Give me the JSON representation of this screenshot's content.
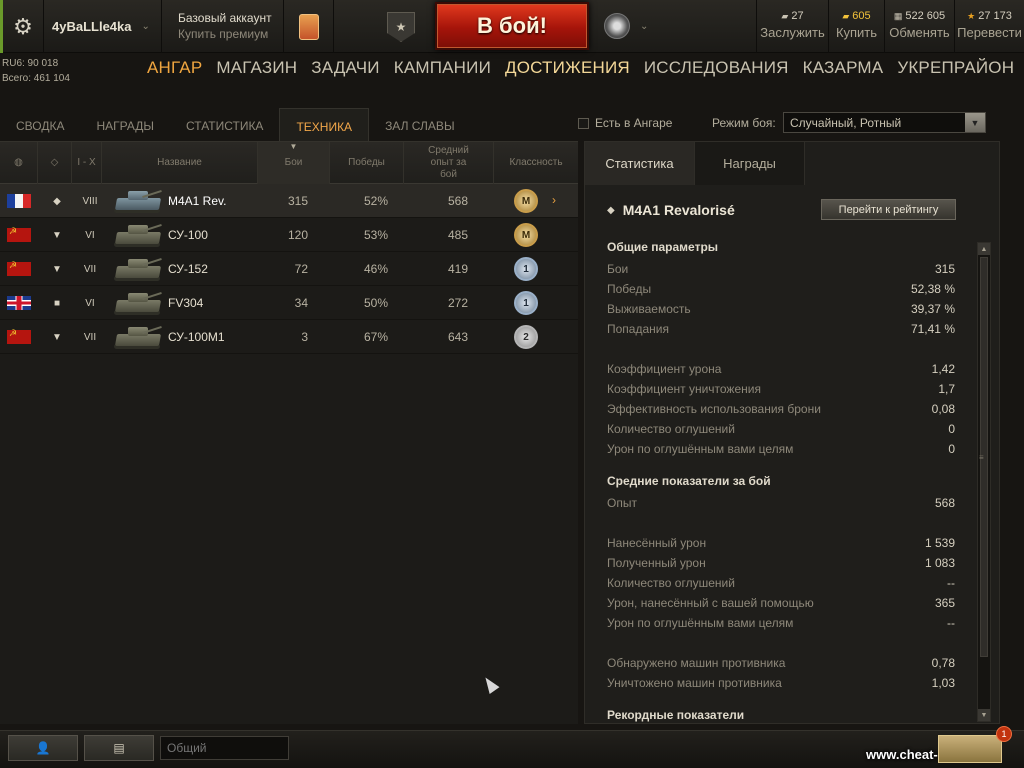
{
  "header": {
    "player_name": "4yBaLLle4ka",
    "account_type": "Базовый аккаунт",
    "buy_premium": "Купить премиум",
    "battle_button": "В бой!",
    "currencies": [
      {
        "id": "xp",
        "amount": "27",
        "caption": "Заслужить",
        "icon": "xp-icon",
        "color": "#c9c3b3"
      },
      {
        "id": "gold",
        "amount": "605",
        "caption": "Купить",
        "icon": "gold-icon",
        "color": "#f2c23a"
      },
      {
        "id": "credits",
        "amount": "522 605",
        "caption": "Обменять",
        "icon": "credits-icon",
        "color": "#c9c3b3"
      },
      {
        "id": "free_xp",
        "amount": "27 173",
        "caption": "Перевести",
        "icon": "free-xp-icon",
        "color": "#e8a020"
      }
    ]
  },
  "left_stats": {
    "rub": "RU6: 90 018",
    "total": "Всего: 461 104"
  },
  "nav": {
    "items": [
      "АНГАР",
      "МАГАЗИН",
      "ЗАДАЧИ",
      "КАМПАНИИ",
      "ДОСТИЖЕНИЯ",
      "ИССЛЕДОВАНИЯ",
      "КАЗАРМА",
      "УКРЕПРАЙОН"
    ],
    "active_hangar": "АНГАР",
    "active_section": "ДОСТИЖЕНИЯ"
  },
  "subtabs": [
    "СВОДКА",
    "НАГРАДЫ",
    "СТАТИСТИКА",
    "ТЕХНИКА",
    "ЗАЛ СЛАВЫ"
  ],
  "active_subtab": "ТЕХНИКА",
  "filter": {
    "in_hangar_label": "Есть в Ангаре",
    "in_hangar_checked": false,
    "mode_label": "Режим боя:",
    "mode_value": "Случайный, Ротный"
  },
  "table": {
    "headers": {
      "tier": "I - X",
      "name": "Название",
      "battles": "Бои",
      "wins": "Победы",
      "avg_xp": "Средний опыт за бой",
      "mastery": "Классность"
    },
    "rows": [
      {
        "nation": "france",
        "type": "heavy",
        "tier": "VIII",
        "name": "M4A1 Rev.",
        "battles": "315",
        "wins": "52%",
        "avg_xp": "568",
        "mastery": "M",
        "selected": true
      },
      {
        "nation": "ussr",
        "type": "td",
        "tier": "VI",
        "name": "СУ-100",
        "battles": "120",
        "wins": "53%",
        "avg_xp": "485",
        "mastery": "M",
        "selected": false
      },
      {
        "nation": "ussr",
        "type": "td",
        "tier": "VII",
        "name": "СУ-152",
        "battles": "72",
        "wins": "46%",
        "avg_xp": "419",
        "mastery": "1",
        "selected": false
      },
      {
        "nation": "uk",
        "type": "spg",
        "tier": "VI",
        "name": "FV304",
        "battles": "34",
        "wins": "50%",
        "avg_xp": "272",
        "mastery": "1",
        "selected": false
      },
      {
        "nation": "ussr",
        "type": "td",
        "tier": "VII",
        "name": "СУ-100М1",
        "battles": "3",
        "wins": "67%",
        "avg_xp": "643",
        "mastery": "2",
        "selected": false
      }
    ]
  },
  "detail": {
    "tabs": [
      "Статистика",
      "Награды"
    ],
    "vehicle_title": "M4A1 Revalorisé",
    "rating_button": "Перейти к рейтингу",
    "sections": {
      "general": "Общие параметры",
      "average": "Средние показатели за бой",
      "records": "Рекордные показатели"
    },
    "general_rows": [
      {
        "label": "Бои",
        "value": "315"
      },
      {
        "label": "Победы",
        "value": "52,38 %"
      },
      {
        "label": "Выживаемость",
        "value": "39,37 %"
      },
      {
        "label": "Попадания",
        "value": "71,41 %"
      },
      {
        "label": "Коэффициент урона",
        "value": "1,42"
      },
      {
        "label": "Коэффициент уничтожения",
        "value": "1,7"
      },
      {
        "label": "Эффективность использования брони",
        "value": "0,08"
      },
      {
        "label": "Количество оглушений",
        "value": "0"
      },
      {
        "label": "Урон по оглушённым вами целям",
        "value": "0"
      }
    ],
    "average_rows": [
      {
        "label": "Опыт",
        "value": "568"
      },
      {
        "label": "Нанесённый урон",
        "value": "1 539"
      },
      {
        "label": "Полученный урон",
        "value": "1 083"
      },
      {
        "label": "Количество оглушений",
        "value": "--"
      },
      {
        "label": "Урон, нанесённый с вашей помощью",
        "value": "365"
      },
      {
        "label": "Урон по оглушённым вами целям",
        "value": "--"
      },
      {
        "label": "Обнаружено машин противника",
        "value": "0,78"
      },
      {
        "label": "Уничтожено машин противника",
        "value": "1,03"
      }
    ]
  },
  "bottom": {
    "chat_placeholder": "Общий",
    "notification_count": "1",
    "watermark": "www.cheat-master.ru"
  }
}
